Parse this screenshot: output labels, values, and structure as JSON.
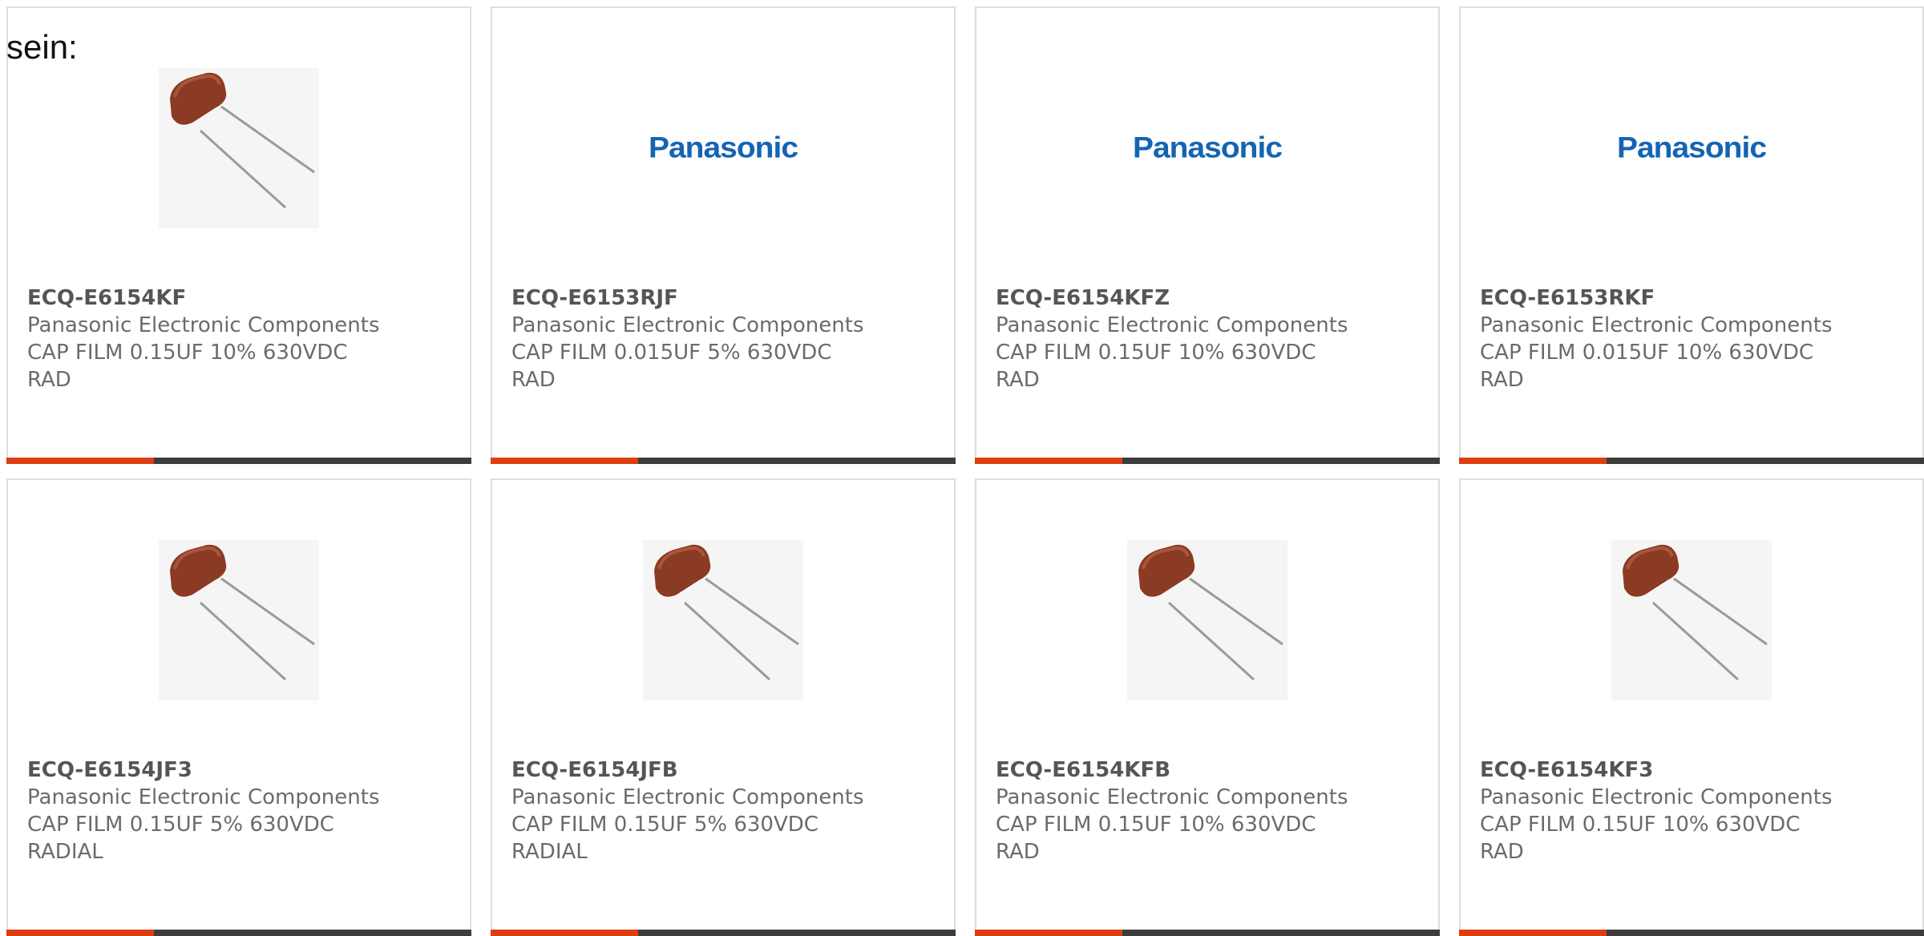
{
  "intro_text": "sein:",
  "colors": {
    "accent": "#e03c14",
    "bar": "#3c3c3c",
    "logo": "#1464b4",
    "capacitor": "#8b3a24"
  },
  "cards": [
    {
      "part_number": "ECQ-E6154KF",
      "manufacturer": "Panasonic Electronic Components",
      "desc_line1": "CAP FILM 0.15UF 10% 630VDC",
      "desc_line2": "RAD",
      "image": "capacitor"
    },
    {
      "part_number": "ECQ-E6153RJF",
      "manufacturer": "Panasonic Electronic Components",
      "desc_line1": "CAP FILM 0.015UF 5% 630VDC",
      "desc_line2": "RAD",
      "image": "logo",
      "logo_text": "Panasonic"
    },
    {
      "part_number": "ECQ-E6154KFZ",
      "manufacturer": "Panasonic Electronic Components",
      "desc_line1": "CAP FILM 0.15UF 10% 630VDC",
      "desc_line2": "RAD",
      "image": "logo",
      "logo_text": "Panasonic"
    },
    {
      "part_number": "ECQ-E6153RKF",
      "manufacturer": "Panasonic Electronic Components",
      "desc_line1": "CAP FILM 0.015UF 10% 630VDC",
      "desc_line2": "RAD",
      "image": "logo",
      "logo_text": "Panasonic"
    },
    {
      "part_number": "ECQ-E6154JF3",
      "manufacturer": "Panasonic Electronic Components",
      "desc_line1": "CAP FILM 0.15UF 5% 630VDC",
      "desc_line2": "RADIAL",
      "image": "capacitor"
    },
    {
      "part_number": "ECQ-E6154JFB",
      "manufacturer": "Panasonic Electronic Components",
      "desc_line1": "CAP FILM 0.15UF 5% 630VDC",
      "desc_line2": "RADIAL",
      "image": "capacitor"
    },
    {
      "part_number": "ECQ-E6154KFB",
      "manufacturer": "Panasonic Electronic Components",
      "desc_line1": "CAP FILM 0.15UF 10% 630VDC",
      "desc_line2": "RAD",
      "image": "capacitor"
    },
    {
      "part_number": "ECQ-E6154KF3",
      "manufacturer": "Panasonic Electronic Components",
      "desc_line1": "CAP FILM 0.15UF 10% 630VDC",
      "desc_line2": "RAD",
      "image": "capacitor"
    }
  ]
}
